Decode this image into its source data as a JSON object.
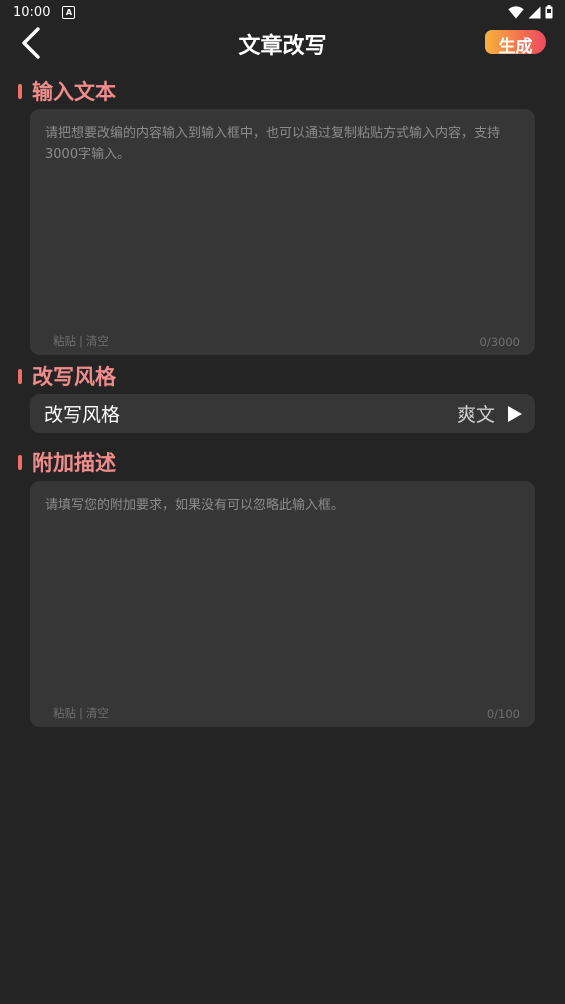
{
  "status_bar": {
    "time": "10:00",
    "notification_letter": "A"
  },
  "app_bar": {
    "title": "文章改写",
    "generate_label": "生成"
  },
  "input_section": {
    "title": "输入文本",
    "placeholder": "请把想要改编的内容输入到输入框中，也可以通过复制粘贴方式输入内容，支持3000字输入。",
    "paste_label": "粘贴",
    "separator": "|",
    "clear_label": "清空",
    "counter": "0/3000"
  },
  "style_section": {
    "title": "改写风格",
    "row_label": "改写风格",
    "row_value": "爽文"
  },
  "extra_section": {
    "title": "附加描述",
    "placeholder": "请填写您的附加要求，如果没有可以忽略此输入框。",
    "paste_label": "粘贴",
    "separator": "|",
    "clear_label": "清空",
    "counter": "0/100"
  },
  "colors": {
    "background": "#242424",
    "card": "#363636",
    "accent_marker": "#ef6f6a",
    "section_title": "#f08c8c",
    "generate_gradient_start": "#f6b23c",
    "generate_gradient_end": "#ee4a62"
  },
  "icons": {
    "back": "chevron-left-icon",
    "style_arrow": "play-triangle-icon",
    "wifi": "wifi-icon",
    "signal": "signal-icon",
    "battery": "battery-icon"
  }
}
